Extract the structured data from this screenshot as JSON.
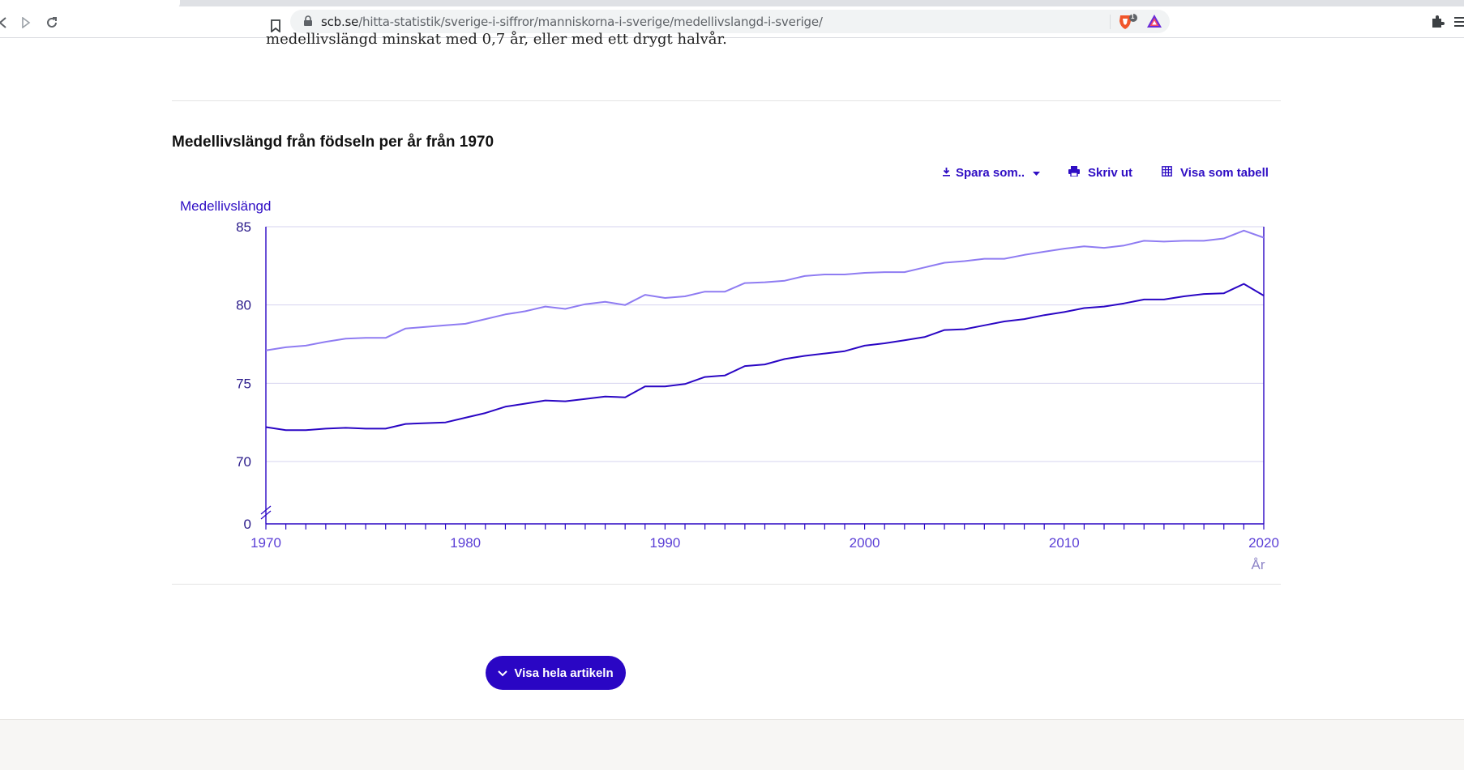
{
  "browser": {
    "url_host": "scb.se",
    "url_path": "/hitta-statistik/sverige-i-siffror/manniskorna-i-sverige/medellivslangd-i-sverige/",
    "shield_count": "1"
  },
  "page": {
    "intro_text": "medellivslängd minskat med 0,7 år, eller med ett drygt halvår.",
    "chart_title": "Medellivslängd från födseln per år från 1970",
    "actions": {
      "save_label": "Spara som..",
      "print_label": "Skriv ut",
      "table_label": "Visa som tabell"
    },
    "cta_label": "Visa hela artikeln"
  },
  "colors": {
    "accent": "#2a06c4",
    "series_dark": "#2a06c4",
    "series_light": "#8f7cf2",
    "grid": "#d6d3ef"
  },
  "icons": {
    "back": "back-arrow-icon",
    "forward": "forward-arrow-icon",
    "reload": "reload-icon",
    "bookmark": "bookmark-icon",
    "lock": "lock-icon",
    "extensions": "puzzle-icon",
    "download": "download-icon",
    "print": "printer-icon",
    "table": "table-grid-icon",
    "chevron": "chevron-down-icon"
  },
  "chart_data": {
    "type": "line",
    "title": "Medellivslängd från födseln per år från 1970",
    "ylabel": "Medellivslängd",
    "xlabel": "År",
    "yticks": [
      0,
      70,
      75,
      80,
      85
    ],
    "xticks": [
      1970,
      1980,
      1990,
      2000,
      2010,
      2020
    ],
    "y_axis_break": true,
    "ylim": [
      68,
      85
    ],
    "xlim": [
      1970,
      2020
    ],
    "grid": true,
    "legend": "none",
    "x": [
      1970,
      1971,
      1972,
      1973,
      1974,
      1975,
      1976,
      1977,
      1978,
      1979,
      1980,
      1981,
      1982,
      1983,
      1984,
      1985,
      1986,
      1987,
      1988,
      1989,
      1990,
      1991,
      1992,
      1993,
      1994,
      1995,
      1996,
      1997,
      1998,
      1999,
      2000,
      2001,
      2002,
      2003,
      2004,
      2005,
      2006,
      2007,
      2008,
      2009,
      2010,
      2011,
      2012,
      2013,
      2014,
      2015,
      2016,
      2017,
      2018,
      2019,
      2020
    ],
    "series": [
      {
        "values": [
          77.1,
          77.3,
          77.4,
          77.65,
          77.85,
          77.9,
          77.9,
          78.5,
          78.6,
          78.7,
          78.8,
          79.1,
          79.4,
          79.6,
          79.9,
          79.75,
          80.05,
          80.2,
          80.0,
          80.65,
          80.45,
          80.55,
          80.85,
          80.85,
          81.4,
          81.45,
          81.55,
          81.85,
          81.95,
          81.95,
          82.05,
          82.1,
          82.1,
          82.4,
          82.7,
          82.8,
          82.95,
          82.95,
          83.2,
          83.4,
          83.6,
          83.75,
          83.65,
          83.8,
          84.1,
          84.05,
          84.1,
          84.1,
          84.25,
          84.75,
          84.3
        ]
      },
      {
        "values": [
          72.2,
          72.0,
          72.0,
          72.1,
          72.15,
          72.1,
          72.1,
          72.4,
          72.45,
          72.5,
          72.8,
          73.1,
          73.5,
          73.7,
          73.9,
          73.85,
          74.0,
          74.15,
          74.1,
          74.8,
          74.8,
          74.95,
          75.4,
          75.5,
          76.1,
          76.2,
          76.55,
          76.75,
          76.9,
          77.05,
          77.4,
          77.55,
          77.75,
          77.95,
          78.4,
          78.45,
          78.7,
          78.95,
          79.1,
          79.35,
          79.55,
          79.8,
          79.9,
          80.1,
          80.35,
          80.35,
          80.55,
          80.7,
          80.75,
          81.35,
          80.6
        ]
      }
    ]
  }
}
